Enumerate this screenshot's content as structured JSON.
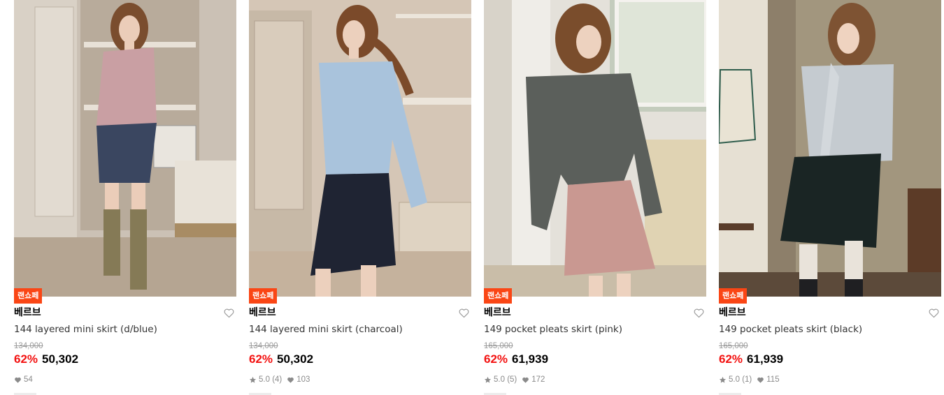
{
  "products": [
    {
      "badge": "랜쇼페",
      "brand": "베르브",
      "name": "144 layered mini skirt (d/blue)",
      "original_price": "134,000",
      "discount": "62%",
      "sale_price": "50,302",
      "rating": "",
      "review_count": "",
      "likes": "54",
      "photo": {
        "wall": "#c9bfb3",
        "floor": "#b7a794",
        "top": "#c99fa3",
        "bottom": "#3a4660"
      }
    },
    {
      "badge": "랜쇼페",
      "brand": "베르브",
      "name": "144 layered mini skirt (charcoal)",
      "original_price": "134,000",
      "discount": "62%",
      "sale_price": "50,302",
      "rating": "5.0",
      "review_count": "(4)",
      "likes": "103",
      "photo": {
        "wall": "#d5c6b6",
        "floor": "#c8b6a2",
        "top": "#a9c3dc",
        "bottom": "#1f2433"
      }
    },
    {
      "badge": "랜쇼페",
      "brand": "베르브",
      "name": "149 pocket pleats skirt (pink)",
      "original_price": "165,000",
      "discount": "62%",
      "sale_price": "61,939",
      "rating": "5.0",
      "review_count": "(5)",
      "likes": "172",
      "photo": {
        "wall": "#e4e1da",
        "floor": "#c9bda8",
        "top": "#5b5f5b",
        "bottom": "#c99891"
      }
    },
    {
      "badge": "랜쇼페",
      "brand": "베르브",
      "name": "149 pocket pleats skirt (black)",
      "original_price": "165,000",
      "discount": "62%",
      "sale_price": "61,939",
      "rating": "5.0",
      "review_count": "(1)",
      "likes": "115",
      "photo": {
        "wall": "#8d7f6a",
        "floor": "#5c4a3a",
        "top": "#c5cbd0",
        "bottom": "#1a2524"
      }
    }
  ],
  "colors": {
    "badge_bg": "#fa4615",
    "discount": "#f31110",
    "muted": "#8a8a8a"
  },
  "icons": {
    "wishlist": "heart-outline-icon",
    "like": "heart-filled-icon",
    "rating": "star-icon"
  }
}
